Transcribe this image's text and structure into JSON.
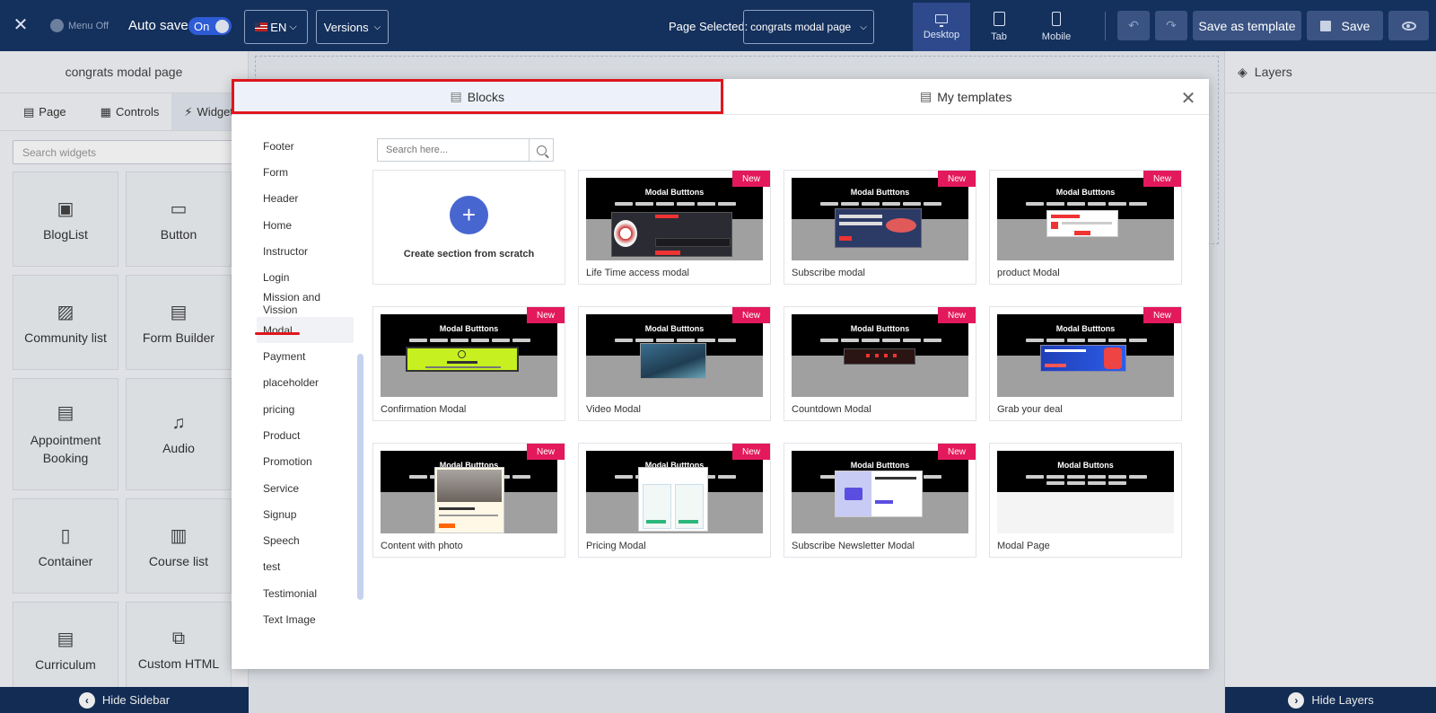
{
  "topbar": {
    "menu_toggle_label": "Menu Off",
    "autosave_label": "Auto save:",
    "autosave_state": "On",
    "language": "EN",
    "versions_label": "Versions",
    "page_selected_label": "Page Selected:",
    "page_selected_value": "congrats modal page",
    "devices": [
      {
        "label": "Desktop",
        "icon": "desktop-icon"
      },
      {
        "label": "Tab",
        "icon": "tablet-icon"
      },
      {
        "label": "Mobile",
        "icon": "mobile-icon"
      }
    ],
    "save_template_label": "Save as template",
    "save_label": "Save"
  },
  "sidebar": {
    "title": "congrats modal page",
    "tabs": [
      "Page",
      "Controls",
      "Widget"
    ],
    "search_placeholder": "Search widgets",
    "widgets": [
      {
        "label": "BlogList",
        "icon": "bloglist-icon"
      },
      {
        "label": "Button",
        "icon": "button-icon"
      },
      {
        "label": "Community list",
        "icon": "community-icon"
      },
      {
        "label": "Form Builder",
        "icon": "form-builder-icon"
      },
      {
        "label": "Appointment Booking",
        "icon": "appointment-icon"
      },
      {
        "label": "Audio",
        "icon": "audio-icon"
      },
      {
        "label": "Container",
        "icon": "container-icon"
      },
      {
        "label": "Course list",
        "icon": "course-list-icon"
      },
      {
        "label": "Curriculum",
        "icon": "curriculum-icon"
      },
      {
        "label": "Custom HTML",
        "icon": "custom-html-icon"
      }
    ],
    "hide_label": "Hide Sidebar"
  },
  "layers": {
    "title": "Layers",
    "hide_label": "Hide Layers"
  },
  "modal": {
    "tabs": [
      "Blocks",
      "My templates"
    ],
    "categories": [
      "Footer",
      "Form",
      "Header",
      "Home",
      "Instructor",
      "Login",
      "Mission and Vission",
      "Modal",
      "Payment",
      "placeholder",
      "pricing",
      "Product",
      "Promotion",
      "Service",
      "Signup",
      "Speech",
      "test",
      "Testimonial",
      "Text Image"
    ],
    "selected_category": "Modal",
    "search_placeholder": "Search here...",
    "scratch_label": "Create section from scratch",
    "thumb_title": "Modal Butttons",
    "thumb_title_alt": "Modal Buttons",
    "badge": "New",
    "templates": [
      {
        "label": "Life Time access modal",
        "new": true
      },
      {
        "label": "Subscribe modal",
        "new": true
      },
      {
        "label": "product Modal",
        "new": true
      },
      {
        "label": "Confirmation Modal",
        "new": true
      },
      {
        "label": "Video Modal",
        "new": true
      },
      {
        "label": "Countdown Modal",
        "new": true
      },
      {
        "label": "Grab your deal",
        "new": true
      },
      {
        "label": "Content with photo",
        "new": true
      },
      {
        "label": "Pricing Modal",
        "new": true
      },
      {
        "label": "Subscribe Newsletter Modal",
        "new": true
      },
      {
        "label": "Modal Page",
        "new": false
      }
    ]
  }
}
